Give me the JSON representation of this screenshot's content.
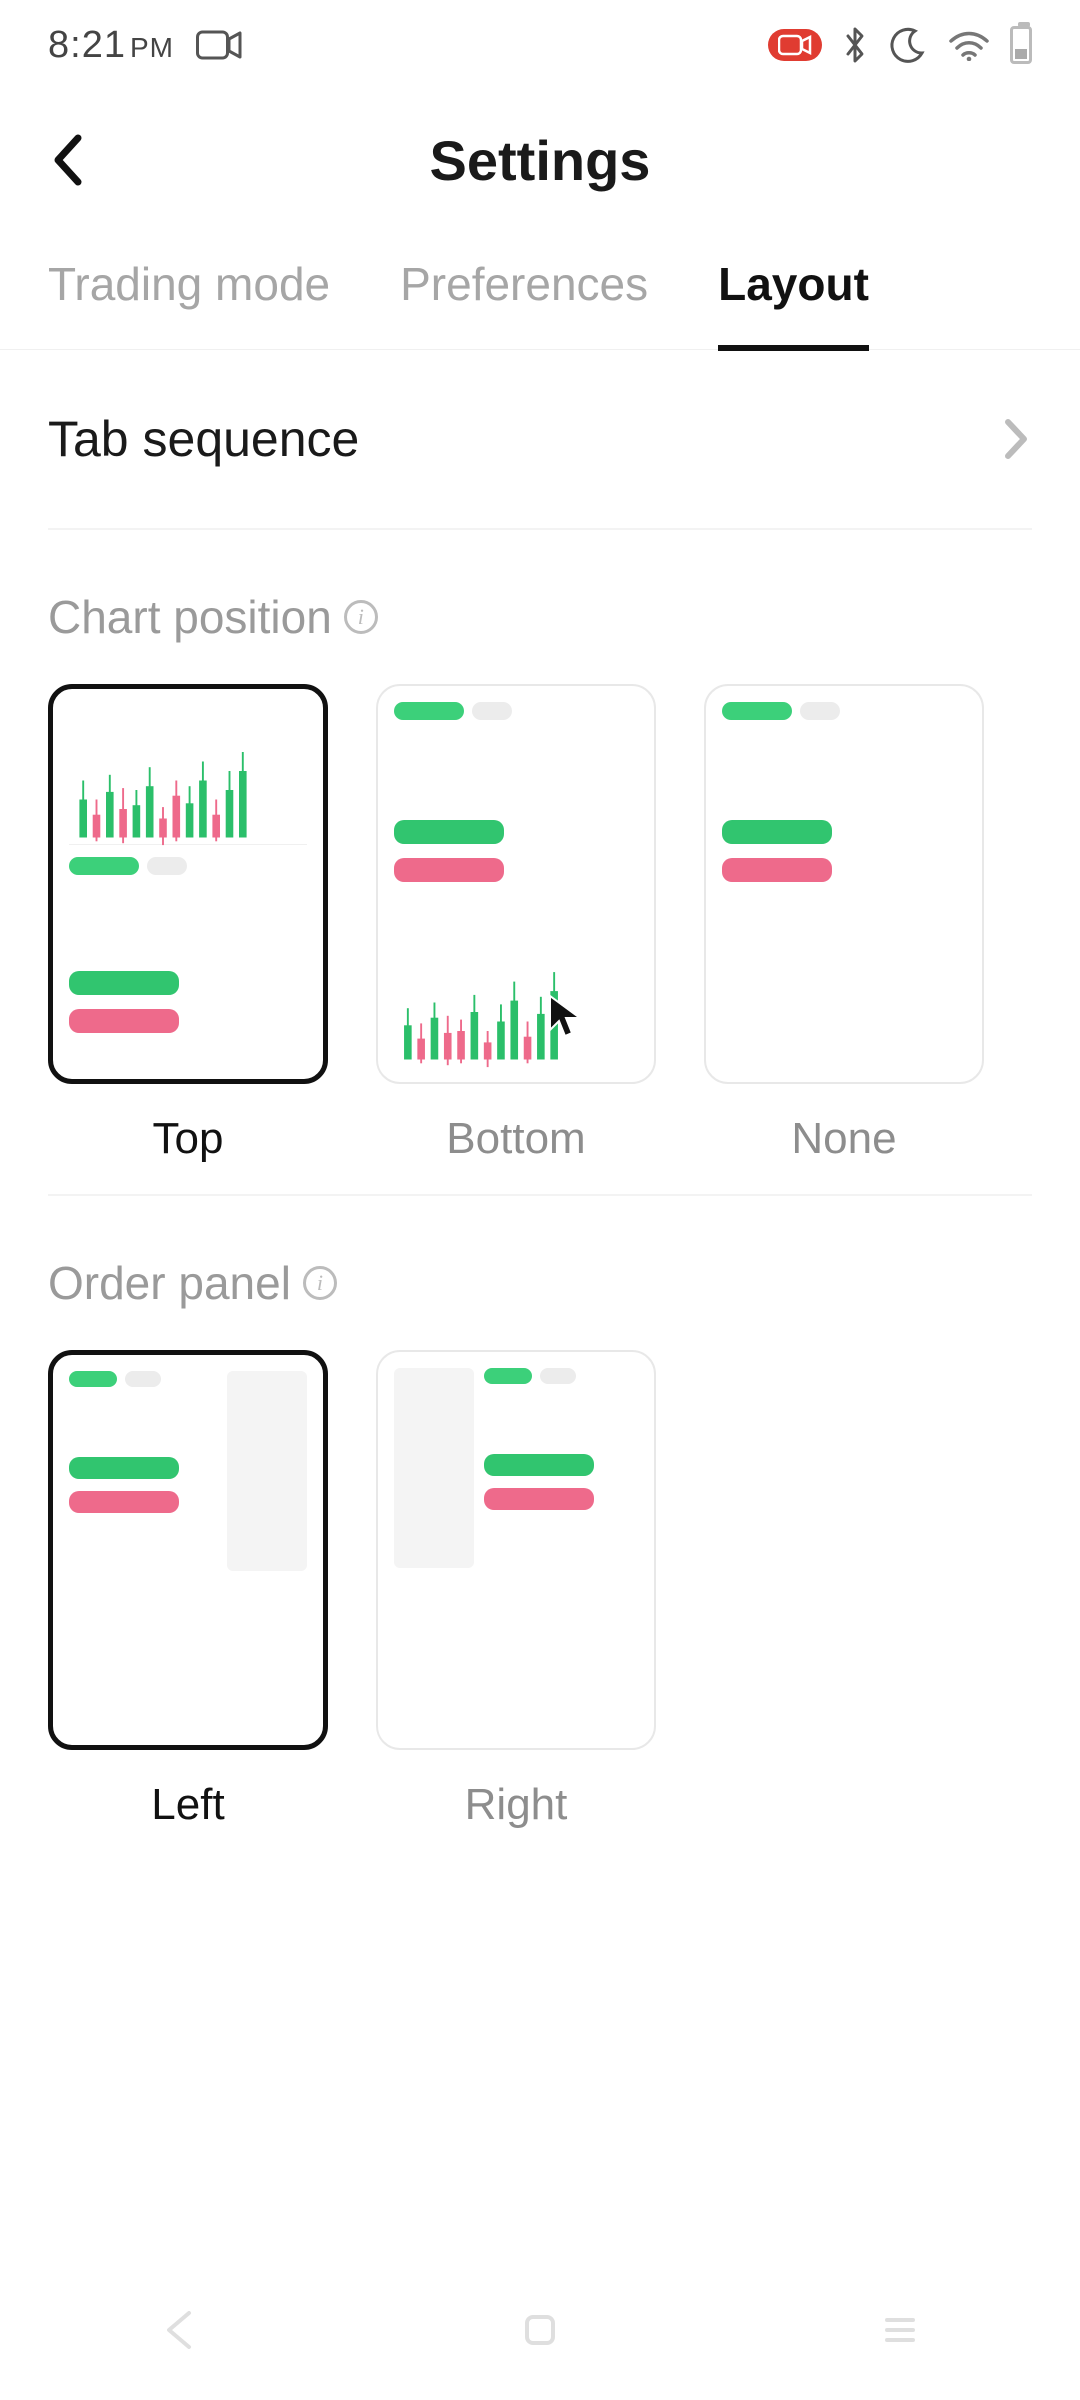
{
  "status": {
    "time": "8:21",
    "ampm": "PM"
  },
  "header": {
    "title": "Settings"
  },
  "tabs": [
    {
      "label": "Trading mode",
      "active": false
    },
    {
      "label": "Preferences",
      "active": false
    },
    {
      "label": "Layout",
      "active": true
    }
  ],
  "rows": {
    "tab_sequence_label": "Tab sequence"
  },
  "sections": {
    "chart_position": {
      "title": "Chart position",
      "options": [
        {
          "label": "Top",
          "selected": true
        },
        {
          "label": "Bottom",
          "selected": false
        },
        {
          "label": "None",
          "selected": false
        }
      ]
    },
    "order_panel": {
      "title": "Order panel",
      "options": [
        {
          "label": "Left",
          "selected": true
        },
        {
          "label": "Right",
          "selected": false
        }
      ]
    }
  }
}
